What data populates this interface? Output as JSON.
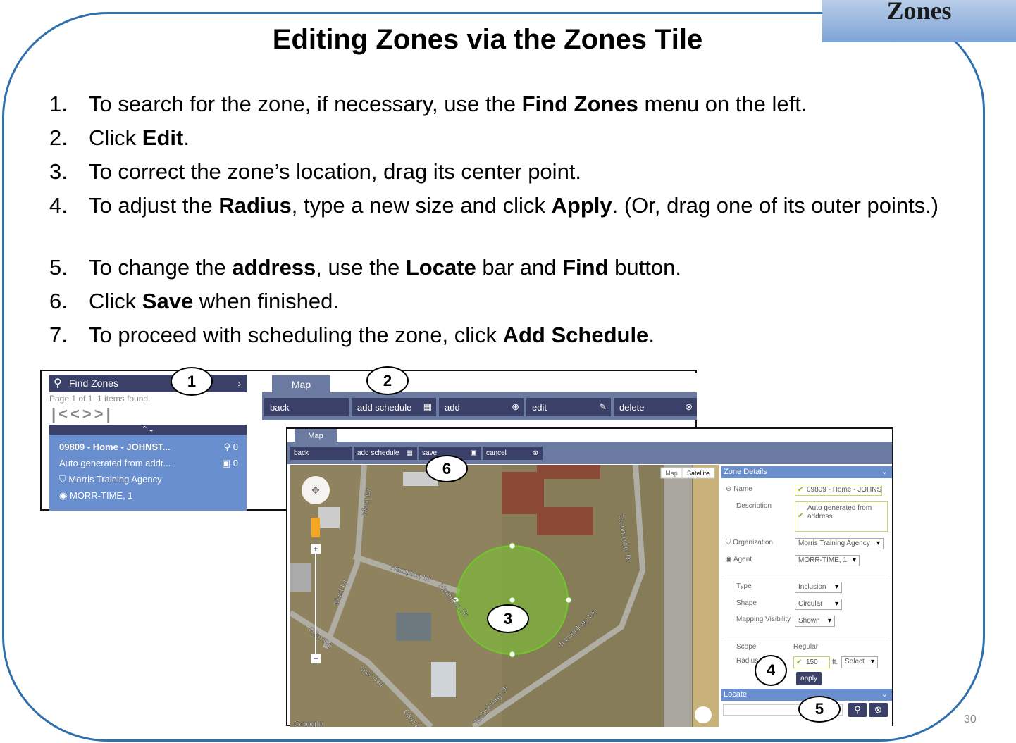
{
  "header": {
    "tab": "Zones",
    "title": "Editing Zones via the Zones Tile"
  },
  "steps": [
    {
      "n": "1.",
      "parts": [
        "To search for the zone, if necessary, use the ",
        "Find Zones",
        " menu on the left."
      ]
    },
    {
      "n": "2.",
      "parts": [
        "Click ",
        "Edit",
        "."
      ]
    },
    {
      "n": "3.",
      "parts": [
        "To correct the zone’s location, drag its center point.",
        "",
        ""
      ]
    },
    {
      "n": "4.",
      "parts": [
        "To adjust the ",
        "Radius",
        ", type a new size and click ",
        "Apply",
        ". (Or, drag one of its outer points.)"
      ]
    },
    {
      "n": "5.",
      "parts": [
        "To change the ",
        "address",
        ", use the ",
        "Locate",
        " bar and ",
        "Find",
        " button."
      ]
    },
    {
      "n": "6.",
      "parts": [
        "Click ",
        "Save",
        " when finished."
      ]
    },
    {
      "n": "7.",
      "parts": [
        "To proceed with scheduling the zone, click ",
        "Add Schedule",
        "."
      ]
    }
  ],
  "shot1": {
    "find_zones": "Find Zones",
    "page_info": "Page 1 of 1. 1 items found.",
    "zone": {
      "name": "09809 - Home - JOHNST...",
      "desc": "Auto generated from addr...",
      "org": "Morris Training Agency",
      "agent": "MORR-TIME, 1",
      "pins": "0",
      "people": "0"
    },
    "tab": "Map",
    "buttons": [
      "back",
      "add schedule",
      "add",
      "edit",
      "delete"
    ]
  },
  "shot2": {
    "tab": "Map",
    "buttons": [
      "back",
      "add schedule",
      "save",
      "cancel"
    ],
    "map": {
      "type_buttons": [
        "Map",
        "Satellite"
      ],
      "streets": [
        "Mast Dr",
        "Mast Dr",
        "Hampton Dr",
        "Hampton Dr",
        "Technology Dr",
        "Technology Dr",
        "Technology Dr",
        "Glen Rd",
        "Glen Rd",
        "Glen Rd"
      ],
      "logo": "Google"
    },
    "details": {
      "header": "Zone Details",
      "name_label": "Name",
      "name_value": "09809 - Home - JOHNS",
      "desc_label": "Description",
      "desc_value": "Auto generated from address",
      "org_label": "Organization",
      "org_value": "Morris Training Agency",
      "agent_label": "Agent",
      "agent_value": "MORR-TIME, 1",
      "type_label": "Type",
      "type_value": "Inclusion",
      "shape_label": "Shape",
      "shape_value": "Circular",
      "vis_label": "Mapping Visibility",
      "vis_value": "Shown",
      "scope_label": "Scope",
      "scope_value": "Regular",
      "radius_label": "Radius",
      "radius_value": "150",
      "radius_unit": "ft.",
      "radius_select": "Select",
      "apply": "apply"
    },
    "locate": {
      "header": "Locate",
      "value": ""
    }
  },
  "callouts": [
    "1",
    "2",
    "3",
    "4",
    "5",
    "6"
  ],
  "page_number": "30",
  "colors": {
    "frame": "#2e6fae",
    "dark_bar": "#3b4068",
    "panel_blue": "#6a8fce",
    "zone_green": "#7cc733"
  }
}
